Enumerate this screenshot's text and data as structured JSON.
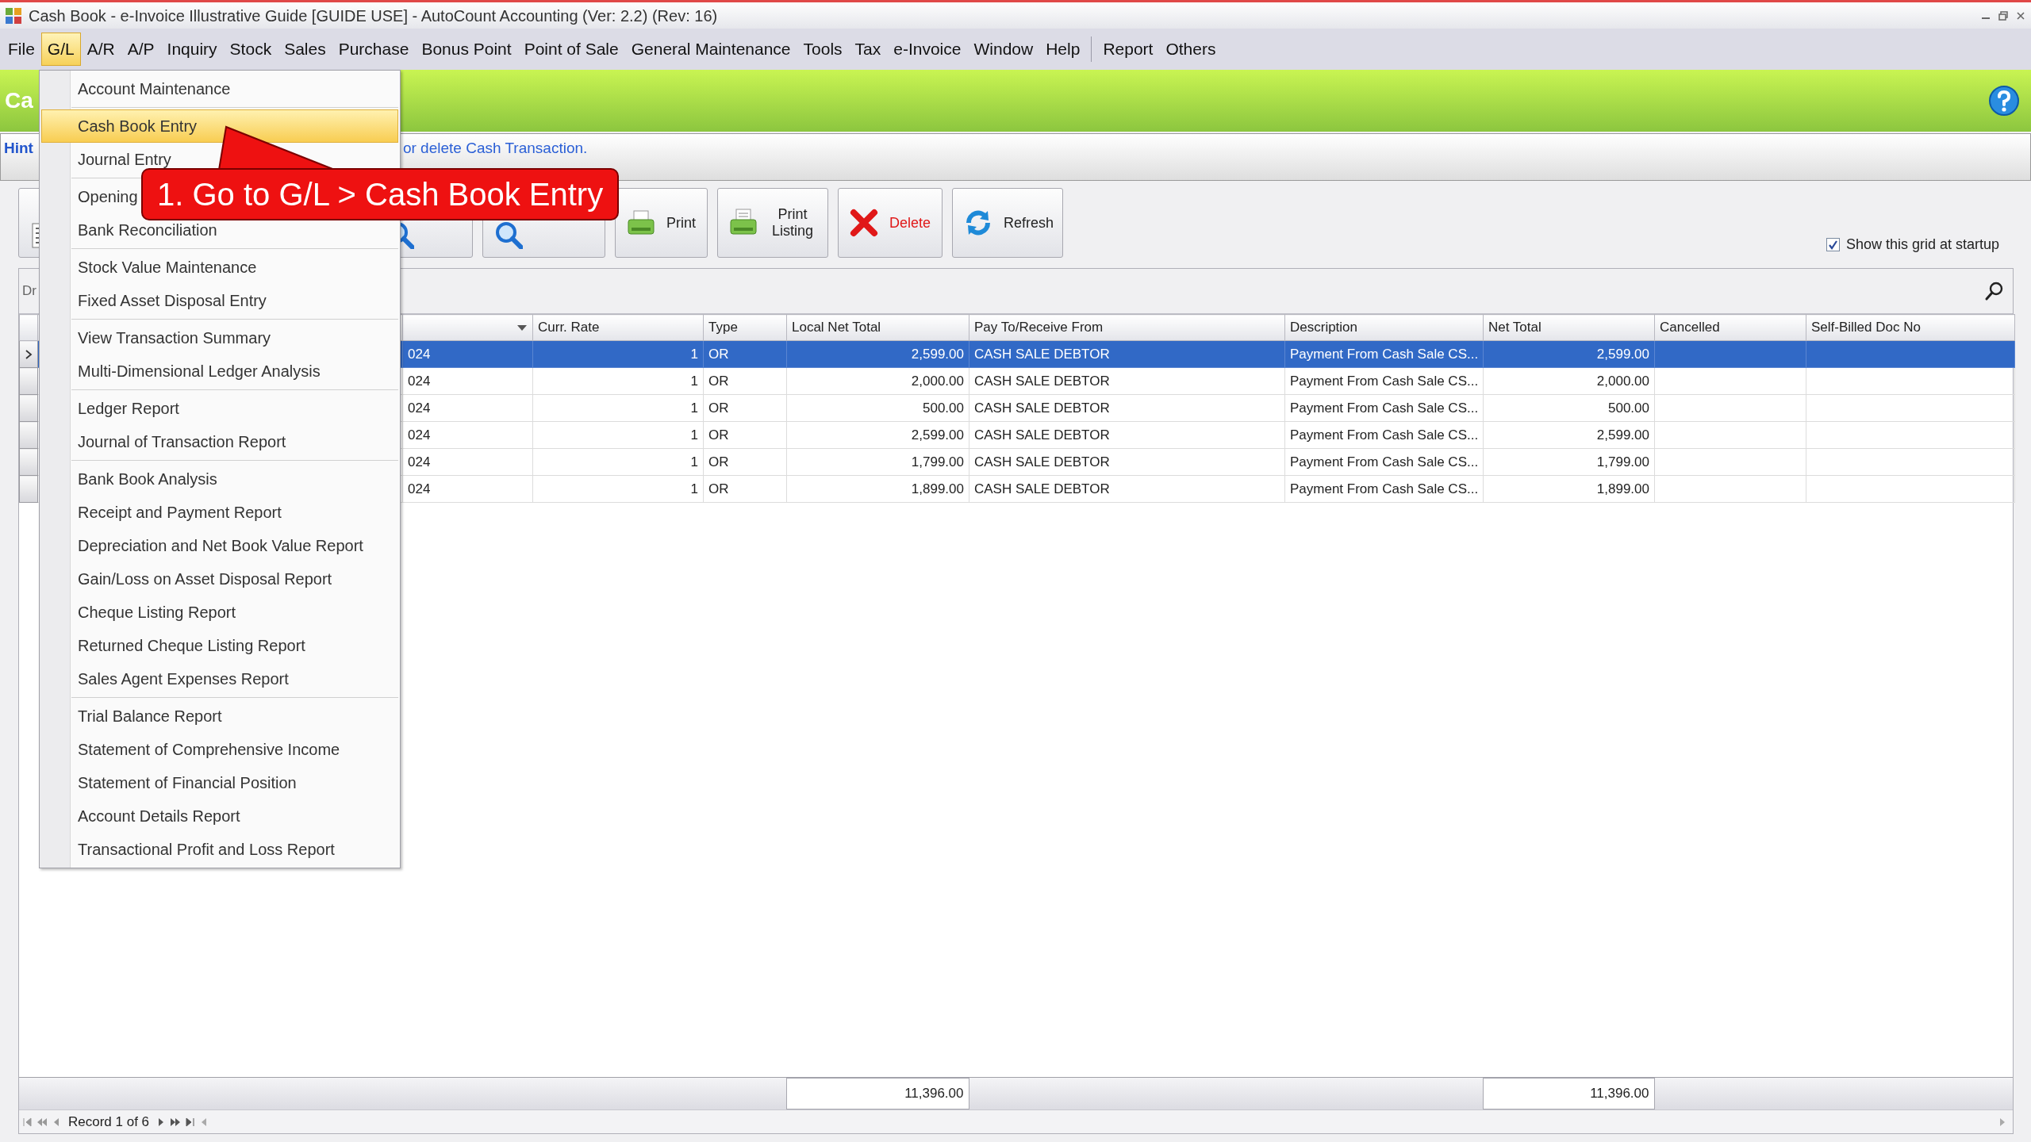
{
  "window": {
    "title": "Cash Book - e-Invoice Illustrative Guide [GUIDE USE] - AutoCount Accounting (Ver: 2.2) (Rev: 16)"
  },
  "menu_bar": {
    "main": [
      {
        "label": "File",
        "selected": false
      },
      {
        "label": "G/L",
        "selected": true
      },
      {
        "label": "A/R",
        "selected": false
      },
      {
        "label": "A/P",
        "selected": false
      },
      {
        "label": "Inquiry",
        "selected": false
      },
      {
        "label": "Stock",
        "selected": false
      },
      {
        "label": "Sales",
        "selected": false
      },
      {
        "label": "Purchase",
        "selected": false
      },
      {
        "label": "Bonus Point",
        "selected": false
      },
      {
        "label": "Point of Sale",
        "selected": false
      },
      {
        "label": "General Maintenance",
        "selected": false
      },
      {
        "label": "Tools",
        "selected": false
      },
      {
        "label": "Tax",
        "selected": false
      },
      {
        "label": "e-Invoice",
        "selected": false
      },
      {
        "label": "Window",
        "selected": false
      },
      {
        "label": "Help",
        "selected": false
      }
    ],
    "extra": [
      {
        "label": "Report",
        "selected": false
      },
      {
        "label": "Others",
        "selected": false
      }
    ]
  },
  "header": {
    "title": "Ca"
  },
  "hint": {
    "label": "Hint",
    "text": "or delete Cash Transaction."
  },
  "toolbar": [
    {
      "kind": "partial-list"
    },
    {
      "kind": "partial-search"
    },
    {
      "kind": "partial-search"
    },
    {
      "kind": "print",
      "label": "Print"
    },
    {
      "kind": "print-listing",
      "label": "Print Listing"
    },
    {
      "kind": "delete",
      "label": "Delete"
    },
    {
      "kind": "refresh",
      "label": "Refresh"
    }
  ],
  "startup_option": {
    "label": "Show this grid at startup",
    "checked": true
  },
  "group_panel": {
    "text": "Dr"
  },
  "table": {
    "columns": [
      {
        "filter": true
      },
      {
        "label": "Curr. Rate"
      },
      {
        "label": "Type"
      },
      {
        "label": "Local Net Total"
      },
      {
        "label": "Pay To/Receive From"
      },
      {
        "label": "Description"
      },
      {
        "label": "Net Total"
      },
      {
        "label": "Cancelled"
      },
      {
        "label": "Self-Billed Doc No"
      }
    ],
    "rows": [
      {
        "selected": true,
        "cells": [
          "024",
          "1",
          "OR",
          "2,599.00",
          "CASH SALE DEBTOR",
          "Payment From Cash Sale CS...",
          "2,599.00"
        ]
      },
      {
        "selected": false,
        "cells": [
          "024",
          "1",
          "OR",
          "2,000.00",
          "CASH SALE DEBTOR",
          "Payment From Cash Sale CS...",
          "2,000.00"
        ]
      },
      {
        "selected": false,
        "cells": [
          "024",
          "1",
          "OR",
          "500.00",
          "CASH SALE DEBTOR",
          "Payment From Cash Sale CS...",
          "500.00"
        ]
      },
      {
        "selected": false,
        "cells": [
          "024",
          "1",
          "OR",
          "2,599.00",
          "CASH SALE DEBTOR",
          "Payment From Cash Sale CS...",
          "2,599.00"
        ]
      },
      {
        "selected": false,
        "cells": [
          "024",
          "1",
          "OR",
          "1,799.00",
          "CASH SALE DEBTOR",
          "Payment From Cash Sale CS...",
          "1,799.00"
        ]
      },
      {
        "selected": false,
        "cells": [
          "024",
          "1",
          "OR",
          "1,899.00",
          "CASH SALE DEBTOR",
          "Payment From Cash Sale CS...",
          "1,899.00"
        ]
      }
    ],
    "totals": {
      "local_net_total": "11,396.00",
      "net_total": "11,396.00"
    }
  },
  "navigator": {
    "text": "Record 1 of 6"
  },
  "dropdown_menu": {
    "groups": [
      [
        {
          "label": "Account Maintenance",
          "selected": false
        }
      ],
      [
        {
          "label": "Cash Book Entry",
          "selected": true
        },
        {
          "label": "Journal Entry",
          "selected": false
        }
      ],
      [
        {
          "label": "Opening",
          "selected": false
        },
        {
          "label": "Bank Reconciliation",
          "selected": false
        }
      ],
      [
        {
          "label": "Stock Value Maintenance",
          "selected": false
        },
        {
          "label": "Fixed Asset Disposal Entry",
          "selected": false
        }
      ],
      [
        {
          "label": "View Transaction Summary",
          "selected": false
        },
        {
          "label": "Multi-Dimensional Ledger Analysis",
          "selected": false
        }
      ],
      [
        {
          "label": "Ledger Report",
          "selected": false
        },
        {
          "label": "Journal of Transaction Report",
          "selected": false
        }
      ],
      [
        {
          "label": "Bank Book Analysis",
          "selected": false
        },
        {
          "label": "Receipt and Payment Report",
          "selected": false
        },
        {
          "label": "Depreciation and Net Book Value Report",
          "selected": false
        },
        {
          "label": "Gain/Loss on Asset Disposal Report",
          "selected": false
        },
        {
          "label": "Cheque Listing Report",
          "selected": false
        },
        {
          "label": "Returned Cheque Listing Report",
          "selected": false
        },
        {
          "label": "Sales Agent Expenses Report",
          "selected": false
        }
      ],
      [
        {
          "label": "Trial Balance Report",
          "selected": false
        },
        {
          "label": "Statement of Comprehensive Income",
          "selected": false
        },
        {
          "label": "Statement of Financial Position",
          "selected": false
        },
        {
          "label": "Account Details Report",
          "selected": false
        },
        {
          "label": "Transactional Profit and Loss Report",
          "selected": false
        }
      ]
    ]
  },
  "callout": {
    "text": "1. Go to G/L > Cash Book Entry"
  }
}
